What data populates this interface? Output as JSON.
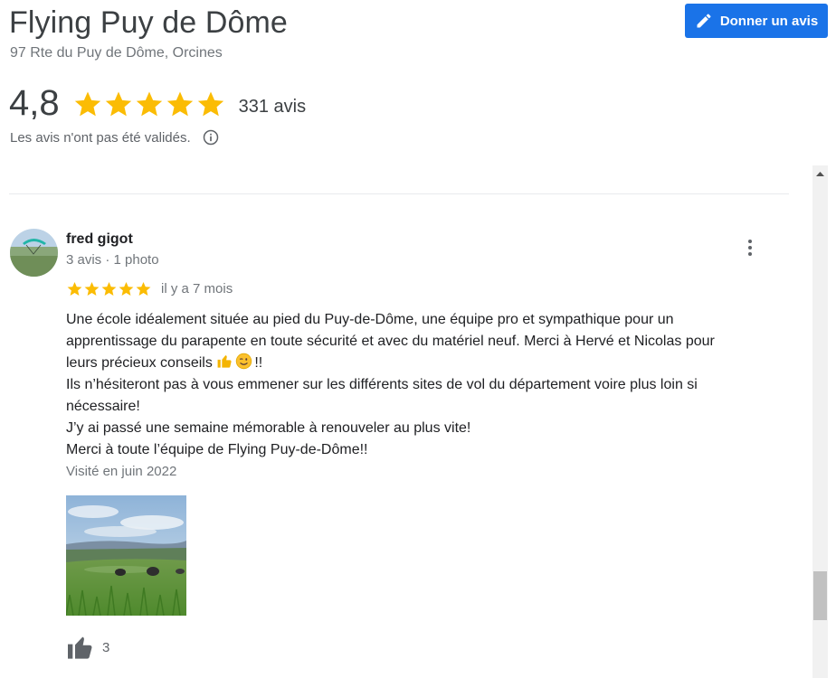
{
  "place": {
    "title": "Flying Puy de Dôme",
    "address": "97 Rte du Puy de Dôme, Orcines"
  },
  "write_review": {
    "label": "Donner un avis",
    "icon": "pencil-icon"
  },
  "summary": {
    "rating": "4,8",
    "star_count": 5,
    "review_count": "331 avis",
    "unverified_note": "Les avis n'ont pas été validés.",
    "info_icon": "info-icon"
  },
  "colors": {
    "accent": "#1a73e8",
    "star": "#fbbc04",
    "muted_text": "#70757a"
  },
  "review": {
    "author": "fred gigot",
    "meta": "3 avis · 1 photo",
    "stars": 5,
    "date": "il y a 7 mois",
    "line1": "Une école idéalement située au pied du Puy-de-Dôme, une équipe pro et sympathique pour un",
    "line2": "apprentissage du parapente en toute sécurité et avec du matériel neuf. Merci à Hervé et Nicolas pour",
    "line3": "leurs précieux conseils",
    "line3_end": "!!",
    "line4": "Ils n’hésiteront pas à vous emmener sur les différents sites de vol du département voire plus loin si",
    "line5": "nécessaire!",
    "line6": "J’y ai passé une semaine mémorable à renouveler au plus vite!",
    "line7": "Merci à toute l’équipe de Flying Puy-de-Dôme!!",
    "emojis": [
      "thumbs-up-emoji",
      "winking-face-emoji"
    ],
    "visited": "Visité en juin 2022",
    "likes": "3"
  }
}
